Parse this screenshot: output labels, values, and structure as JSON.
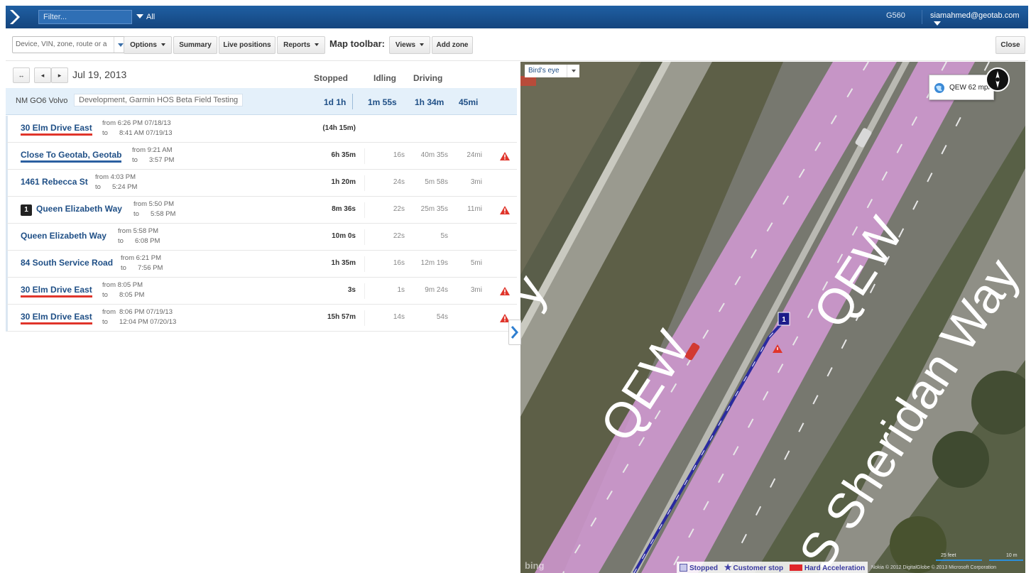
{
  "header": {
    "filter_placeholder": "Filter...",
    "all_label": "All",
    "database": "G560",
    "user": "siamahmed@geotab.com"
  },
  "toolbar": {
    "search_placeholder": "Device, VIN, zone, route or a",
    "options_label": "Options",
    "summary_label": "Summary",
    "live_positions_label": "Live positions",
    "reports_label": "Reports",
    "map_toolbar_label": "Map toolbar:",
    "views_label": "Views",
    "add_zone_label": "Add zone",
    "close_label": "Close"
  },
  "trips": {
    "date": "Jul 19, 2013",
    "columns": {
      "stopped": "Stopped",
      "idling": "Idling",
      "driving": "Driving"
    },
    "summary": {
      "device": "NM GO6 Volvo",
      "groups": "Development, Garmin HOS Beta Field Testing",
      "stopped": "1d 1h",
      "idling": "1m 55s",
      "driving": "1h 34m",
      "distance": "45mi"
    },
    "rows": [
      {
        "name": "30 Elm Drive East",
        "from": "from 6:26 PM 07/18/13",
        "to": "to",
        "to_time": "8:41 AM 07/19/13",
        "stopped": "(14h 15m)",
        "idling": "",
        "driving": "",
        "distance": ""
      },
      {
        "name": "Close To Geotab, Geotab",
        "from": "from 9:21 AM",
        "to": "to",
        "to_time": "3:57 PM",
        "stopped": "6h 35m",
        "idling": "16s",
        "driving": "40m 35s",
        "distance": "24mi"
      },
      {
        "name": "1461 Rebecca St",
        "from": "from 4:03 PM",
        "to": "to",
        "to_time": "5:24 PM",
        "stopped": "1h 20m",
        "idling": "24s",
        "driving": "5m 58s",
        "distance": "3mi"
      },
      {
        "name": "Queen Elizabeth Way",
        "badge": "1",
        "from": "from 5:50 PM",
        "to": "to",
        "to_time": "5:58 PM",
        "stopped": "8m 36s",
        "idling": "22s",
        "driving": "25m 35s",
        "distance": "11mi"
      },
      {
        "name": "Queen Elizabeth Way",
        "from": "from 5:58 PM",
        "to": "to",
        "to_time": "6:08 PM",
        "stopped": "10m 0s",
        "idling": "22s",
        "driving": "5s",
        "distance": ""
      },
      {
        "name": "84 South Service Road",
        "from": "from 6:21 PM",
        "to": "to",
        "to_time": "7:56 PM",
        "stopped": "1h 35m",
        "idling": "16s",
        "driving": "12m 19s",
        "distance": "5mi"
      },
      {
        "name": "30 Elm Drive East",
        "from": "from 8:05 PM",
        "to": "to",
        "to_time": "8:05 PM",
        "stopped": "3s",
        "idling": "1s",
        "driving": "9m 24s",
        "distance": "3mi"
      },
      {
        "name": "30 Elm Drive East",
        "from": "from",
        "from_time": "8:06 PM 07/19/13",
        "to": "to",
        "to_time": "12:04 PM 07/20/13",
        "stopped": "15h 57m",
        "idling": "14s",
        "driving": "54s",
        "distance": ""
      }
    ]
  },
  "map": {
    "view_label": "Bird's eye",
    "tooltip": "QEW 62 mph",
    "road_label_1": "QEW",
    "road_label_2": "QEW",
    "road_label_3": "S Sheridan Way",
    "road_label_4": "y",
    "marker_number": "1",
    "legend": {
      "stopped": "Stopped",
      "customer_stop": "Customer stop",
      "hard_accel": "Hard Acceleration"
    },
    "copyright": "Nokia  © 2012 DigitalGlobe  © 2013 Microsoft Corporation",
    "provider": "bing",
    "scale_feet": "25 feet",
    "scale_m": "10 m"
  },
  "colors": {
    "header_bg": "#1a4f8c",
    "link": "#1f4f86",
    "alert": "#e0352b",
    "route": "#2a2aa0",
    "highway": "#d39ad6"
  }
}
